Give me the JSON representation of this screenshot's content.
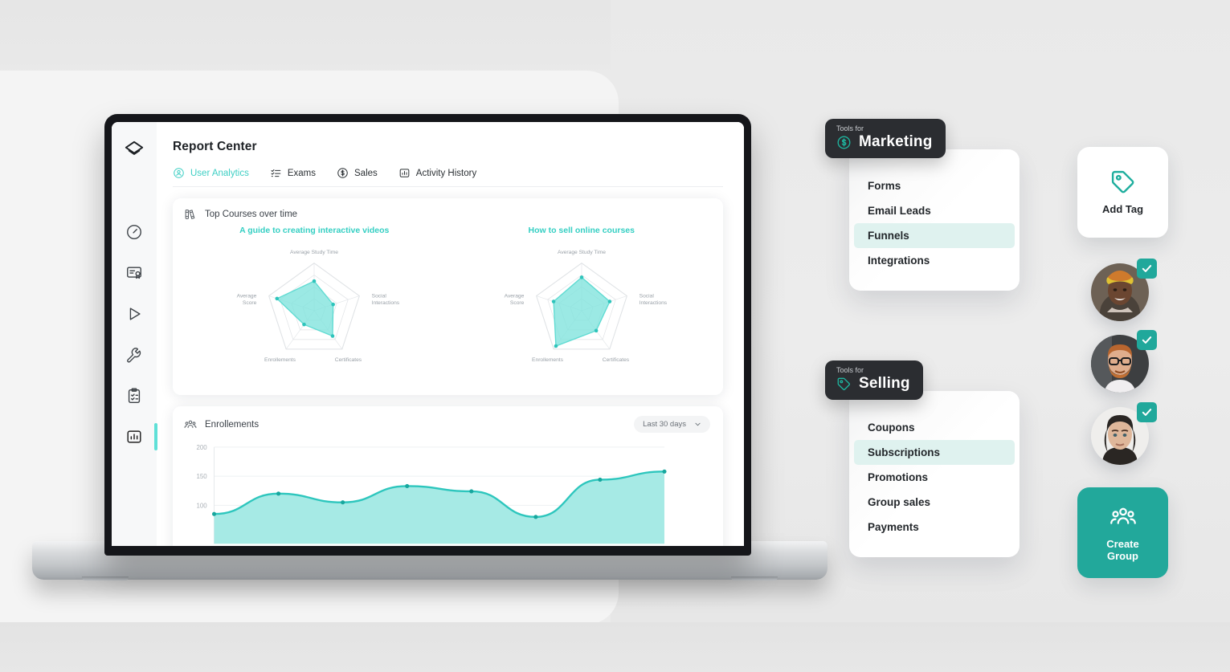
{
  "app": {
    "brand_icon": "layers-logo-icon",
    "page_title": "Report Center",
    "sidebar_items": [
      {
        "icon": "dashboard-gauge-icon",
        "active": false
      },
      {
        "icon": "certificate-icon",
        "active": false
      },
      {
        "icon": "play-icon",
        "active": false
      },
      {
        "icon": "wrench-icon",
        "active": false
      },
      {
        "icon": "clipboard-check-icon",
        "active": false
      },
      {
        "icon": "bar-chart-icon",
        "active": true
      }
    ],
    "tabs": [
      {
        "label": "User Analytics",
        "icon": "user-circle-icon",
        "active": true
      },
      {
        "label": "Exams",
        "icon": "checklist-icon",
        "active": false
      },
      {
        "label": "Sales",
        "icon": "dollar-circle-icon",
        "active": false
      },
      {
        "label": "Activity History",
        "icon": "bar-chart-icon",
        "active": false
      }
    ]
  },
  "top_courses_card": {
    "icon": "books-icon",
    "title": "Top Courses over time"
  },
  "enrollments_card": {
    "icon": "people-group-icon",
    "title": "Enrollements",
    "range_selector": {
      "value": "Last 30 days",
      "icon": "chevron-down-icon"
    }
  },
  "marketing_card": {
    "header_sub": "Tools for",
    "header_title": "Marketing",
    "header_icon": "dollar-circle-icon",
    "items": [
      {
        "label": "Forms",
        "selected": false
      },
      {
        "label": "Email Leads",
        "selected": false
      },
      {
        "label": "Funnels",
        "selected": true
      },
      {
        "label": "Integrations",
        "selected": false
      }
    ]
  },
  "selling_card": {
    "header_sub": "Tools for",
    "header_title": "Selling",
    "header_icon": "tag-icon",
    "items": [
      {
        "label": "Coupons",
        "selected": false
      },
      {
        "label": "Subscriptions",
        "selected": true
      },
      {
        "label": "Promotions",
        "selected": false
      },
      {
        "label": "Group sales",
        "selected": false
      },
      {
        "label": "Payments",
        "selected": false
      }
    ]
  },
  "add_tag_card": {
    "label": "Add Tag",
    "icon": "tag-icon"
  },
  "create_group_card": {
    "label": "Create\nGroup",
    "label_line1": "Create",
    "label_line2": "Group",
    "icon": "people-group-icon"
  },
  "avatars": [
    {
      "name": "avatar-1",
      "verified": true,
      "badge_icon": "check-icon"
    },
    {
      "name": "avatar-2",
      "verified": true,
      "badge_icon": "check-icon"
    },
    {
      "name": "avatar-3",
      "verified": true,
      "badge_icon": "check-icon"
    }
  ],
  "colors": {
    "accent_teal": "#3ecfc4",
    "brand_teal": "#22a89b",
    "chart_fill": "#9fe9e3",
    "chart_stroke": "#3ecfc4",
    "dark_panel": "#2b2d31",
    "text_dark": "#23272b"
  },
  "chart_data": [
    {
      "type": "radar",
      "title": "A guide to creating interactive videos",
      "categories": [
        "Average Study Time",
        "Social Interactions",
        "Certificates",
        "Enrollements",
        "Average Score"
      ],
      "values": [
        62,
        42,
        66,
        36,
        82
      ],
      "max": 100,
      "rings": 4,
      "grid": true,
      "legend": "none"
    },
    {
      "type": "radar",
      "title": "How to sell online courses",
      "categories": [
        "Average Study Time",
        "Social Interactions",
        "Certificates",
        "Enrollements",
        "Average Score"
      ],
      "values": [
        70,
        62,
        52,
        92,
        62
      ],
      "max": 100,
      "rings": 4,
      "grid": true,
      "legend": "none"
    },
    {
      "type": "area",
      "title": "Enrollements",
      "xlabel": "",
      "ylabel": "",
      "ylim": [
        0,
        200
      ],
      "yticks": [
        100,
        150,
        200
      ],
      "grid": true,
      "legend": "none",
      "x": [
        0,
        1,
        2,
        3,
        4,
        5,
        6,
        7
      ],
      "values": [
        85,
        120,
        105,
        133,
        124,
        80,
        144,
        158
      ],
      "series": [
        {
          "name": "Enrollements",
          "values": [
            85,
            120,
            105,
            133,
            124,
            80,
            144,
            158
          ]
        }
      ]
    }
  ]
}
